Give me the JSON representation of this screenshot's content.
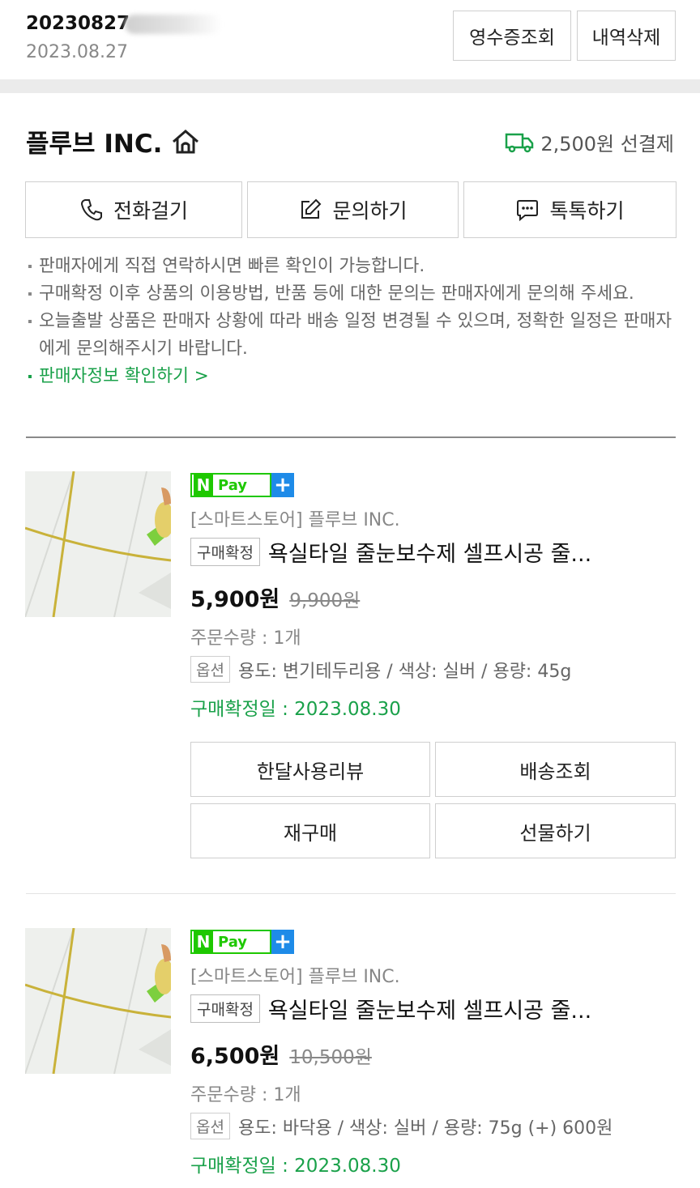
{
  "order": {
    "number": "20230827",
    "date": "2023.08.27"
  },
  "header_buttons": {
    "receipt": "영수증조회",
    "delete": "내역삭제"
  },
  "store": {
    "name": "플루브 INC.",
    "shipping": "2,500원 선결제"
  },
  "contact_buttons": {
    "call": "전화걸기",
    "inquiry": "문의하기",
    "talk": "톡톡하기"
  },
  "notes": [
    "판매자에게 직접 연락하시면 빠른 확인이 가능합니다.",
    "구매확정 이후 상품의 이용방법, 반품 등에 대한 문의는 판매자에게 문의해 주세요.",
    "오늘출발 상품은 판매자 상황에 따라 배송 일정 변경될 수 있으며, 정확한 일정은 판매자에게 문의해주시기 바랍니다."
  ],
  "seller_info_link": "판매자정보 확인하기 >",
  "npay_text": "Pay",
  "items": [
    {
      "store": "[스마트스토어] 플루브 INC.",
      "badge": "구매확정",
      "title": "욕실타일 줄눈보수제 셀프시공 줄...",
      "price": "5,900원",
      "orig_price": "9,900원",
      "qty": "주문수량 : 1개",
      "opt_label": "옵션",
      "option": "용도: 변기테두리용 / 색상: 실버 / 용량: 45g",
      "confirm_date": "구매확정일 : 2023.08.30",
      "buttons": [
        "한달사용리뷰",
        "배송조회",
        "재구매",
        "선물하기"
      ]
    },
    {
      "store": "[스마트스토어] 플루브 INC.",
      "badge": "구매확정",
      "title": "욕실타일 줄눈보수제 셀프시공 줄...",
      "price": "6,500원",
      "orig_price": "10,500원",
      "qty": "주문수량 : 1개",
      "opt_label": "옵션",
      "option": "용도: 바닥용 / 색상: 실버 / 용량: 75g (+) 600원",
      "confirm_date": "구매확정일 : 2023.08.30"
    }
  ],
  "colors": {
    "green": "#1aa14a",
    "npay_green": "#1ec800",
    "npay_blue": "#1e8be8"
  }
}
